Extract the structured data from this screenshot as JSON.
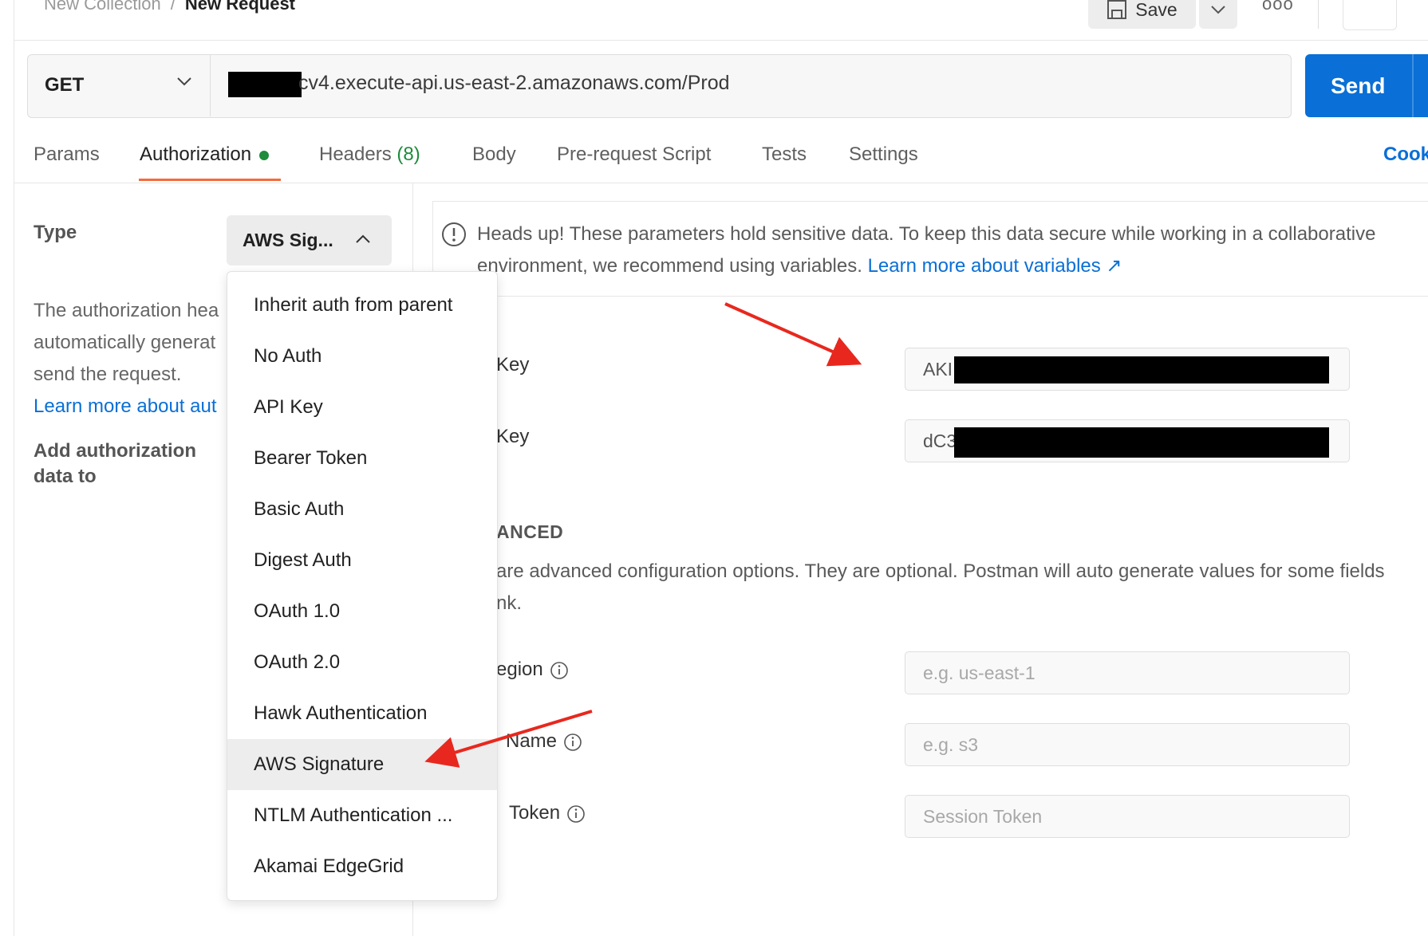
{
  "breadcrumb": {
    "collection": "New Collection",
    "separator": "/",
    "request": "New Request"
  },
  "toolbar": {
    "save_label": "Save",
    "more_label": "ooo"
  },
  "request": {
    "method": "GET",
    "url_visible": "cv4.execute-api.us-east-2.amazonaws.com/Prod",
    "send_label": "Send"
  },
  "tabs": [
    {
      "label": "Params"
    },
    {
      "label": "Authorization"
    },
    {
      "label": "Headers",
      "count": "(8)"
    },
    {
      "label": "Body"
    },
    {
      "label": "Pre-request Script"
    },
    {
      "label": "Tests"
    },
    {
      "label": "Settings"
    }
  ],
  "cookies_label": "Cook",
  "auth": {
    "type_label": "Type",
    "type_value": "AWS Sig...",
    "desc_lines": [
      "The authorization hea",
      "automatically generat",
      "send the request."
    ],
    "learn_more": "Learn more about aut",
    "add_auth_lines": [
      "Add authorization",
      "data to"
    ]
  },
  "dropdown": {
    "items": [
      "Inherit auth from parent",
      "No Auth",
      "API Key",
      "Bearer Token",
      "Basic Auth",
      "Digest Auth",
      "OAuth 1.0",
      "OAuth 2.0",
      "Hawk Authentication",
      "AWS Signature",
      "NTLM Authentication ...",
      "Akamai EdgeGrid"
    ],
    "selected": "AWS Signature"
  },
  "banner": {
    "text": "Heads up! These parameters hold sensitive data. To keep this data secure while working in a collaborative environment, we recommend using variables.",
    "link": "Learn more about variables ↗"
  },
  "fields": {
    "access_key": {
      "label": "Key",
      "value": "AKI"
    },
    "secret_key": {
      "label": "Key",
      "value": "dC3"
    },
    "advanced_title": "ANCED",
    "advanced_text_lines": [
      "are advanced configuration options. They are optional. Postman will auto generate values for some fields",
      "nk."
    ],
    "region": {
      "label": "egion",
      "placeholder": "e.g. us-east-1"
    },
    "service": {
      "label": "Name",
      "placeholder": "e.g. s3"
    },
    "session": {
      "label": "Token",
      "placeholder": "Session Token"
    }
  },
  "colors": {
    "accent_blue": "#0a6fd6",
    "tab_underline": "#f26b3a",
    "status_green": "#1f8b3c",
    "annotation_red": "#e8281e"
  }
}
